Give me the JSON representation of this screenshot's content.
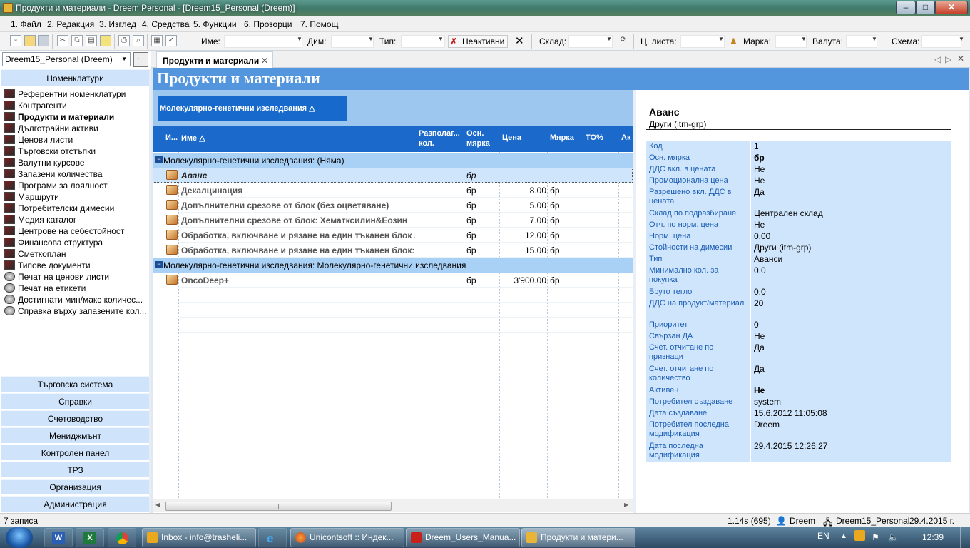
{
  "window": {
    "title": "Продукти и материали - Dreem Personal - [Dreem15_Personal (Dreem)]",
    "min": "–",
    "max": "□",
    "close": "✕"
  },
  "menu": [
    "1. Файл",
    "2. Редакция",
    "3. Изглед",
    "4. Средства",
    "5. Функции",
    "6. Прозорци",
    "7. Помощ"
  ],
  "toolbar": {
    "name_label": "Име:",
    "dim_label": "Дим:",
    "type_label": "Тип:",
    "inactive_label": "Неактивни",
    "warehouse_label": "Склад:",
    "pricelist_label": "Ц. листа:",
    "brand_label": "Марка:",
    "currency_label": "Валута:",
    "scheme_label": "Схема:"
  },
  "left": {
    "db": "Dreem15_Personal (Dreem)",
    "db_btn": "...",
    "header": "Номенклатури",
    "items": [
      {
        "label": "Референтни номенклатури",
        "icon": "book-icon"
      },
      {
        "label": "Контрагенти",
        "icon": "book-icon"
      },
      {
        "label": "Продукти и материали",
        "icon": "book-icon"
      },
      {
        "label": "Дълготрайни активи",
        "icon": "book-icon"
      },
      {
        "label": "Ценови листи",
        "icon": "book-icon"
      },
      {
        "label": "Търговски отстъпки",
        "icon": "book-icon"
      },
      {
        "label": "Валутни курсове",
        "icon": "book-icon"
      },
      {
        "label": "Запазени количества",
        "icon": "book-icon"
      },
      {
        "label": "Програми за лоялност",
        "icon": "book-icon"
      },
      {
        "label": "Маршрути",
        "icon": "book-icon"
      },
      {
        "label": "Потребителски димесии",
        "icon": "book-icon"
      },
      {
        "label": "Медия каталог",
        "icon": "book-icon"
      },
      {
        "label": "Центрове на себестойност",
        "icon": "book-icon"
      },
      {
        "label": "Финансова структура",
        "icon": "book-icon"
      },
      {
        "label": "Сметкоплан",
        "icon": "book-icon"
      },
      {
        "label": "Типове документи",
        "icon": "book-icon"
      },
      {
        "label": "Печат на ценови листи",
        "icon": "gear-icon"
      },
      {
        "label": "Печат на етикети",
        "icon": "gear-icon"
      },
      {
        "label": "Достигнати мин/макс количес...",
        "icon": "gear-icon"
      },
      {
        "label": "Справка върху запазените кол...",
        "icon": "gear-icon"
      }
    ],
    "sections": [
      "Търговска система",
      "Справки",
      "Счетоводство",
      "Мениджмънт",
      "Контролен панел",
      "ТРЗ",
      "Организация",
      "Администрация"
    ]
  },
  "tab": {
    "label": "Продукти и материали",
    "close": "✕"
  },
  "page_title": "Продукти и материали",
  "grid": {
    "group_by": "Молекулярно-генетични изследвания △",
    "columns": [
      "И...",
      "Име △",
      "Разполаг...\nкол.",
      "Осн.\nмярка",
      "Цена",
      "Мярка",
      "ТО%",
      "Ак"
    ],
    "groups": [
      {
        "title": "Молекулярно-генетични изследвания: (Няма)",
        "rows": [
          {
            "name": "Аванс",
            "unit": "бр",
            "price": "",
            "measure": ""
          },
          {
            "name": "Декалцинация",
            "unit": "бр",
            "price": "8.00",
            "measure": "бр"
          },
          {
            "name": "Допълнителни срезове от блок (без оцветяване)",
            "unit": "бр",
            "price": "5.00",
            "measure": "бр"
          },
          {
            "name": "Допълнителни срезове от блок: Хематксилин&Еозин",
            "unit": "бр",
            "price": "7.00",
            "measure": "бр"
          },
          {
            "name": "Обработка, включване и рязане на един тъканен блок ...",
            "unit": "бр",
            "price": "12.00",
            "measure": "бр"
          },
          {
            "name": "Обработка, включване и рязане на един тъканен блок:...",
            "unit": "бр",
            "price": "15.00",
            "measure": "бр"
          }
        ]
      },
      {
        "title": "Молекулярно-генетични изследвания: Молекулярно-генетични изследвания",
        "rows": [
          {
            "name": "OncoDeep+",
            "unit": "бр",
            "price": "3'900.00",
            "measure": "бр"
          }
        ]
      }
    ],
    "scroll_thumb": "|||"
  },
  "detail": {
    "title": "Аванс",
    "subtitle": "Други (itm-grp)",
    "fields": [
      {
        "label": "Код",
        "value": "1"
      },
      {
        "label": "Осн. мярка",
        "value": "бр",
        "bold": true
      },
      {
        "label": "ДДС вкл. в цената",
        "value": "Не"
      },
      {
        "label": "Промоционална цена",
        "value": "Не"
      },
      {
        "label": "Разрешено вкл. ДДС в цената",
        "value": "Да"
      },
      {
        "label": "Склад по подразбиране",
        "value": "Централен склад"
      },
      {
        "label": "Отч. по норм. цена",
        "value": "Не"
      },
      {
        "label": "Норм. цена",
        "value": "0.00"
      },
      {
        "label": "Стойности на димесии",
        "value": "Други (itm-grp)"
      },
      {
        "label": "Тип",
        "value": "Аванси"
      },
      {
        "label": "Минимално кол. за покупка",
        "value": "0.0"
      },
      {
        "label": "Бруто тегло",
        "value": "0.0"
      },
      {
        "label": "ДДС на продукт/материал",
        "value": "20"
      },
      {
        "label": "Приоритет",
        "value": "0"
      },
      {
        "label": "Свързан ДА",
        "value": "Не"
      },
      {
        "label": "Счет. отчитане по признаци",
        "value": "Да"
      },
      {
        "label": "Счет. отчитане по количество",
        "value": "Да"
      },
      {
        "label": "Активен",
        "value": "Не",
        "bold": true
      },
      {
        "label": "Потребител създаване",
        "value": "system"
      },
      {
        "label": "Дата създаване",
        "value": "15.6.2012 11:05:08"
      },
      {
        "label": "Потребител последна модификация",
        "value": "Dreem"
      },
      {
        "label": "Дата последна модификация",
        "value": "29.4.2015 12:26:27"
      }
    ]
  },
  "status": {
    "records": "7 записа",
    "timing": "1.14s (695)",
    "user": "Dreem",
    "db": "Dreem15_Personal",
    "date": "29.4.2015 г."
  },
  "taskbar": {
    "buttons": [
      "Inbox - info@trasheli...",
      "Unicontsoft :: Индек...",
      "Dreem_Users_Manua...",
      "Продукти и матери..."
    ],
    "lang": "EN",
    "clock": "12:39"
  },
  "colors": {
    "header_blue": "#5496de",
    "column_header": "#1b6acb",
    "group_row": "#a9d0f5",
    "detail_bg": "#cfe5fb"
  }
}
